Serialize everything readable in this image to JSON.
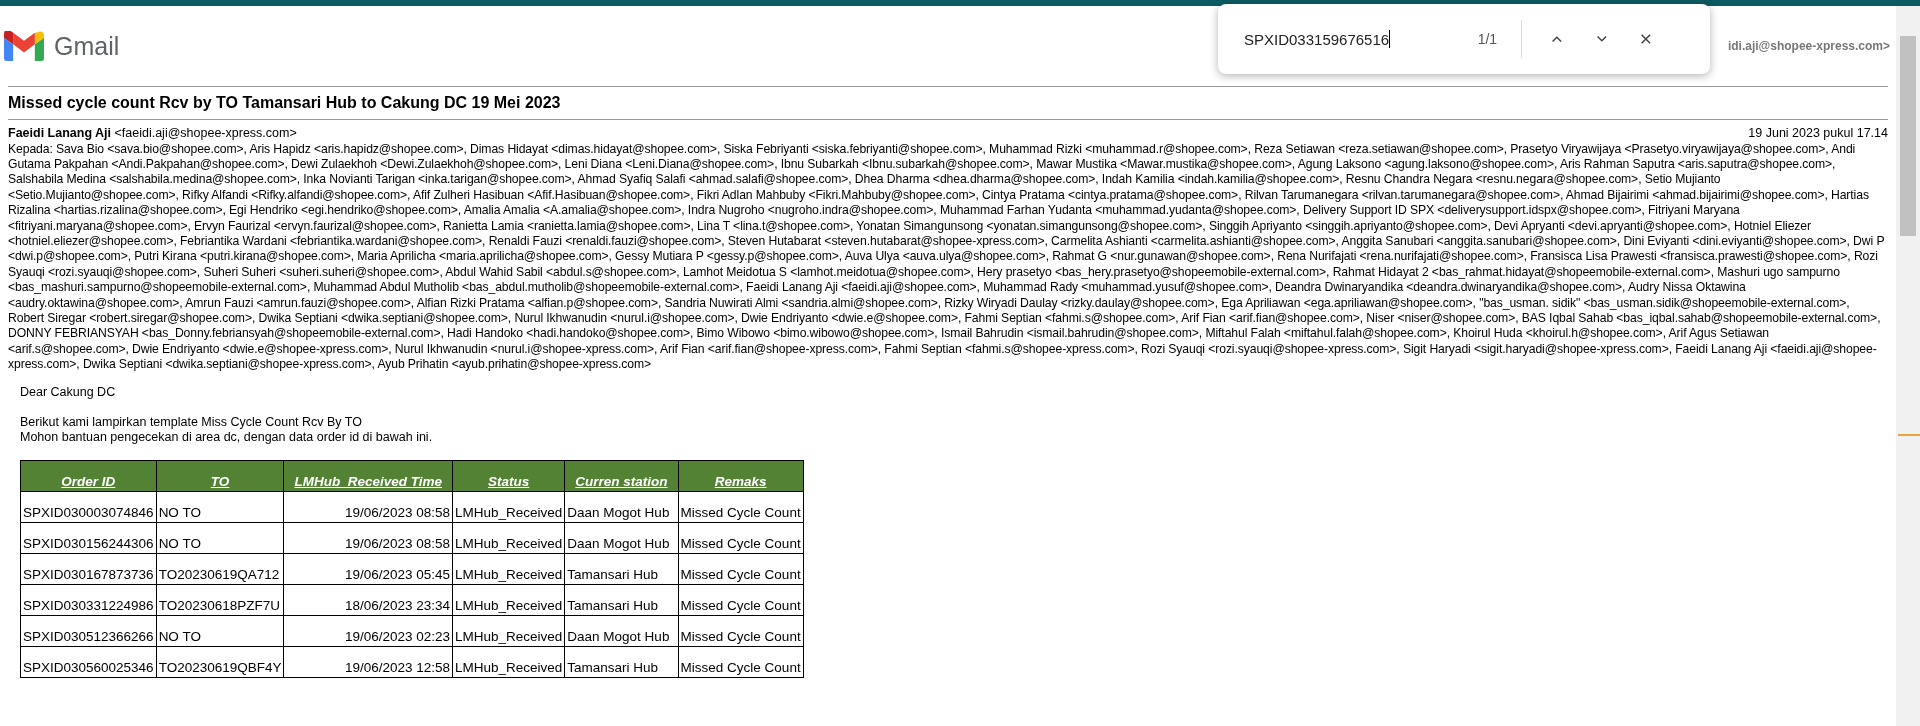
{
  "find_bar": {
    "value": "SPXID033159676516",
    "count": "1/1"
  },
  "header": {
    "logo_text": "Gmail",
    "account": "idi.aji@shopee-xpress.com>"
  },
  "subject": "Missed cycle count Rcv by TO Tamansari Hub to Cakung DC 19 Mei 2023",
  "message": {
    "sender": "**Faeidi Lanang Aji** <faeidi.aji@shopee-xpress.com>",
    "date": "19 Juni 2023 pukul 17.14",
    "recipients": "Kepada: Sava Bio <sava.bio@shopee.com>, Aris Hapidz <aris.hapidz@shopee.com>, Dimas Hidayat <dimas.hidayat@shopee.com>, Siska Febriyanti <siska.febriyanti@shopee.com>, Muhammad Rizki <muhammad.r@shopee.com>, Reza Setiawan <reza.setiawan@shopee.com>, Prasetyo Viryawijaya <Prasetyo.viryawijaya@shopee.com>, Andi Gutama Pakpahan <Andi.Pakpahan@shopee.com>, Dewi Zulaekhoh <Dewi.Zulaekhoh@shopee.com>, Leni Diana <Leni.Diana@shopee.com>, Ibnu Subarkah <Ibnu.subarkah@shopee.com>, Mawar Mustika <Mawar.mustika@shopee.com>, Agung Laksono <agung.laksono@shopee.com>, Aris Rahman Saputra <aris.saputra@shopee.com>, Salshabila Medina <salshabila.medina@shopee.com>, Inka Novianti Tarigan <inka.tarigan@shopee.com>, Ahmad Syafiq Salafi <ahmad.salafi@shopee.com>, Dhea Dharma <dhea.dharma@shopee.com>, Indah Kamilia <indah.kamilia@shopee.com>, Resnu Chandra Negara <resnu.negara@shopee.com>, Setio Mujianto <Setio.Mujianto@shopee.com>, Rifky Alfandi <Rifky.alfandi@shopee.com>, Afif Zulheri Hasibuan <Afif.Hasibuan@shopee.com>, Fikri Adlan Mahbuby <Fikri.Mahbuby@shopee.com>, Cintya Pratama <cintya.pratama@shopee.com>, Rilvan Tarumanegara <rilvan.tarumanegara@shopee.com>, Ahmad Bijairimi <ahmad.bijairimi@shopee.com>, Hartias Rizalina <hartias.rizalina@shopee.com>, Egi Hendriko <egi.hendriko@shopee.com>, Amalia Amalia <A.amalia@shopee.com>, Indra Nugroho <nugroho.indra@shopee.com>, Muhammad Farhan Yudanta <muhammad.yudanta@shopee.com>, Delivery Support ID SPX <deliverysupport.idspx@shopee.com>, Fitriyani Maryana <fitriyani.maryana@shopee.com>, Ervyn Faurizal <ervyn.faurizal@shopee.com>, Ranietta Lamia <ranietta.lamia@shopee.com>, Lina T <lina.t@shopee.com>, Yonatan Simangunsong <yonatan.simangunsong@shopee.com>, Singgih Apriyanto <singgih.apriyanto@shopee.com>, Devi Apryanti <devi.apryanti@shopee.com>, Hotniel Eliezer <hotniel.eliezer@shopee.com>, Febriantika Wardani <febriantika.wardani@shopee.com>, Renaldi Fauzi <renaldi.fauzi@shopee.com>, Steven Hutabarat <steven.hutabarat@shopee-xpress.com>, Carmelita Ashianti <carmelita.ashianti@shopee.com>, Anggita Sanubari <anggita.sanubari@shopee.com>, Dini Eviyanti <dini.eviyanti@shopee.com>, Dwi P <dwi.p@shopee.com>, Putri Kirana <putri.kirana@shopee.com>, Maria Aprilicha <maria.aprilicha@shopee.com>, Gessy Mutiara P <gessy.p@shopee.com>, Auva Ulya <auva.ulya@shopee.com>, Rahmat G <nur.gunawan@shopee.com>, Rena Nurifajati <rena.nurifajati@shopee.com>, Fransisca Lisa Prawesti <fransisca.prawesti@shopee.com>, Rozi Syauqi <rozi.syauqi@shopee.com>, Suheri Suheri <suheri.suheri@shopee.com>, Abdul Wahid Sabil <abdul.s@shopee.com>, Lamhot Meidotua S <lamhot.meidotua@shopee.com>, Hery prasetyo <bas_hery.prasetyo@shopeemobile-external.com>, Rahmat Hidayat 2 <bas_rahmat.hidayat@shopeemobile-external.com>, Mashuri ugo sampurno <bas_mashuri.sampurno@shopeemobile-external.com>, Muhammad Abdul Mutholib <bas_abdul.mutholib@shopeemobile-external.com>, Faeidi Lanang Aji <faeidi.aji@shopee.com>, Muhammad Rady <muhammad.yusuf@shopee.com>, Deandra Dwinaryandika <deandra.dwinaryandika@shopee.com>, Audry Nissa Oktawina <audry.oktawina@shopee.com>, Amrun Fauzi <amrun.fauzi@shopee.com>, Alfian Rizki Pratama <alfian.p@shopee.com>, Sandria Nuwirati Almi <sandria.almi@shopee.com>, Rizky Wiryadi Daulay <rizky.daulay@shopee.com>, Ega Apriliawan <ega.apriliawan@shopee.com>, \"bas_usman. sidik\" <bas_usman.sidik@shopeemobile-external.com>, Robert Siregar <robert.siregar@shopee.com>, Dwika Septiani <dwika.septiani@shopee.com>, Nurul Ikhwanudin <nurul.i@shopee.com>, Dwie Endriyanto <dwie.e@shopee.com>, Fahmi Septian <fahmi.s@shopee.com>, Arif Fian <arif.fian@shopee.com>, Niser <niser@shopee.com>, BAS Iqbal Sahab <bas_iqbal.sahab@shopeemobile-external.com>, DONNY FEBRIANSYAH <bas_Donny.febriansyah@shopeemobile-external.com>, Hadi Handoko <hadi.handoko@shopee.com>, Bimo Wibowo <bimo.wibowo@shopee.com>, Ismail Bahrudin <ismail.bahrudin@shopee.com>, Miftahul Falah <miftahul.falah@shopee.com>, Khoirul Huda <khoirul.h@shopee.com>, Arif Agus Setiawan <arif.s@shopee.com>, Dwie Endriyanto <dwie.e@shopee-xpress.com>, Nurul Ikhwanudin <nurul.i@shopee-xpress.com>, Arif Fian <arif.fian@shopee-xpress.com>, Fahmi Septian <fahmi.s@shopee-xpress.com>, Rozi Syauqi <rozi.syauqi@shopee-xpress.com>, Sigit Haryadi <sigit.haryadi@shopee-xpress.com>, Faeidi Lanang Aji <faeidi.aji@shopee-xpress.com>, Dwika Septiani <dwika.septiani@shopee-xpress.com>, Ayub Prihatin <ayub.prihatin@shopee-xpress.com>",
    "body": [
      [
        "Dear Cakung DC"
      ],
      [
        "Berikut kami lampirkan template Miss Cycle Count Rcv By TO",
        "Mohon bantuan pengecekan di area dc, dengan data order id di bawah ini."
      ]
    ]
  },
  "table": {
    "columns": [
      "Order ID",
      "TO",
      "LMHub_Received Time",
      "Status",
      "Curren station",
      "Remaks"
    ],
    "rows": [
      [
        "SPXID030003074846",
        "NO TO",
        "19/06/2023 08:58",
        "LMHub_Received",
        "Daan Mogot Hub",
        "Missed Cycle Count"
      ],
      [
        "SPXID030156244306",
        "NO TO",
        "19/06/2023 08:58",
        "LMHub_Received",
        "Daan Mogot Hub",
        "Missed Cycle Count"
      ],
      [
        "SPXID030167873736",
        "TO20230619QA712",
        "19/06/2023 05:45",
        "LMHub_Received",
        "Tamansari Hub",
        "Missed Cycle Count"
      ],
      [
        "SPXID030331224986",
        "TO20230618PZF7U",
        "18/06/2023 23:34",
        "LMHub_Received",
        "Tamansari Hub",
        "Missed Cycle Count"
      ],
      [
        "SPXID030512366266",
        "NO TO",
        "19/06/2023 02:23",
        "LMHub_Received",
        "Daan Mogot Hub",
        "Missed Cycle Count"
      ],
      [
        "SPXID030560025346",
        "TO20230619QBF4Y",
        "19/06/2023 12:58",
        "LMHub_Received",
        "Tamansari Hub",
        "Missed Cycle Count"
      ]
    ]
  }
}
